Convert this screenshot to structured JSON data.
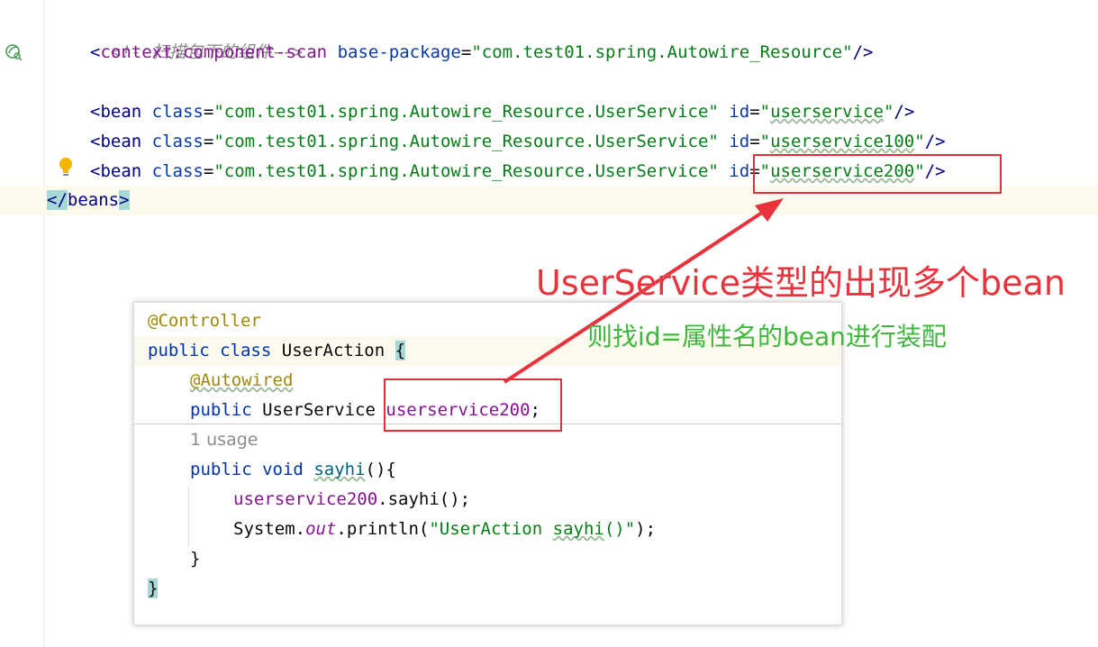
{
  "editor": {
    "comment": "<!--扫描包下的组件-->",
    "scan_line": {
      "open": "<",
      "tag": "context:component-scan",
      "attr": "base-package",
      "eq": "=",
      "value": "\"com.test01.spring.Autowire_Resource\"",
      "close": "/>"
    },
    "beans": [
      {
        "open": "<",
        "tag": "bean",
        "class_attr": "class",
        "class_value": "\"com.test01.spring.Autowire_Resource.UserService\"",
        "id_attr": "id",
        "id_q1": "\"",
        "id_value": "userservice",
        "id_q2": "\"",
        "close": "/>"
      },
      {
        "open": "<",
        "tag": "bean",
        "class_attr": "class",
        "class_value": "\"com.test01.spring.Autowire_Resource.UserService\"",
        "id_attr": "id",
        "id_q1": "\"",
        "id_value": "userservice100",
        "id_q2": "\"",
        "close": "/>"
      },
      {
        "open": "<",
        "tag": "bean",
        "class_attr": "class",
        "class_value": "\"com.test01.spring.Autowire_Resource.UserService\"",
        "id_attr": "id",
        "id_q1": "\"",
        "id_value": "userservice200",
        "id_q2": "\"",
        "close": "/>"
      }
    ],
    "closing": {
      "open": "</",
      "tag": "beans",
      "close": ">"
    }
  },
  "popup": {
    "annotation": "@Controller",
    "kw_public": "public",
    "kw_class": "class",
    "class_name": "UserAction",
    "brace_open": "{",
    "autowired": "@Autowired",
    "field_type": "UserService",
    "field_name": "userservice200",
    "semicolon": ";",
    "usage": "1 usage",
    "kw_void": "void",
    "method_name": "sayhi",
    "method_sig": "(){",
    "call_field": "userservice200",
    "call_rest": ".sayhi();",
    "sys": "System.",
    "out": "out",
    "println": ".println(",
    "str_open": "\"UserAction ",
    "str_sayhi": "sayhi",
    "str_close": "()\"",
    "println_end": ");",
    "brace_close_inner": "}",
    "brace_close_outer": "}"
  },
  "annotations": {
    "title": "UserService类型的出现多个bean",
    "subtitle": "则找id=属性名的bean进行装配"
  },
  "colors": {
    "annotation_red": "#e8323c",
    "annotation_green": "#3db83d"
  }
}
